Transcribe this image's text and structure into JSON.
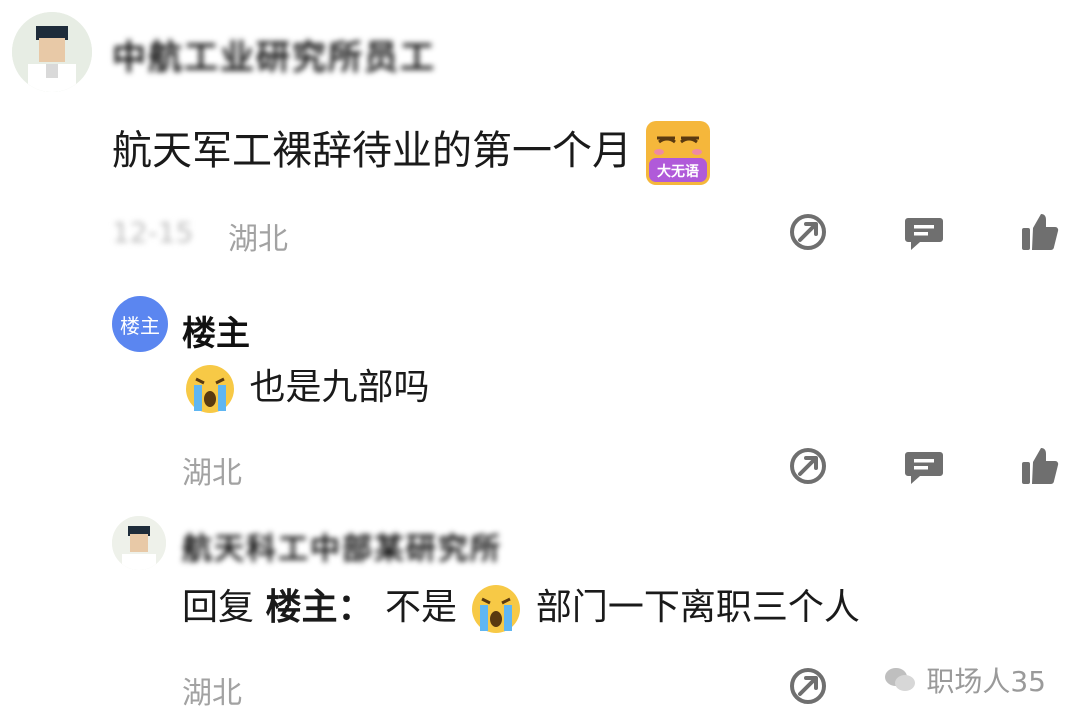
{
  "post": {
    "username": "中航工业研究所员工",
    "content": "航天军工裸辞待业的第一个月",
    "sticker_text": "大无语",
    "date": "12-15",
    "location": "湖北"
  },
  "replies": [
    {
      "author": "楼主",
      "badge": "楼主",
      "text": "也是九部吗",
      "location": "湖北"
    },
    {
      "username": "航天科工中部某研究所",
      "reply_prefix": "回复",
      "reply_to": "楼主：",
      "text_before": "不是",
      "text_after": "部门一下离职三个人",
      "location": "湖北"
    }
  ],
  "watermark": "职场人35",
  "icons": [
    "share-icon",
    "comment-icon",
    "like-icon"
  ],
  "colors": {
    "accent": "#5b86f0",
    "icon_gray": "#6f6f6f",
    "text_gray": "#a2a2a2"
  }
}
